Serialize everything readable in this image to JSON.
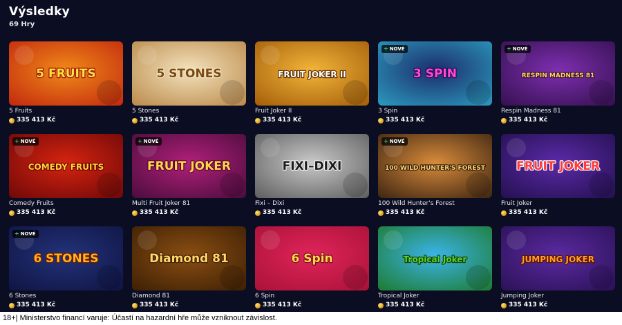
{
  "header": {
    "title": "Výsledky",
    "count": "69 Hry"
  },
  "badge_label": "NOVÉ",
  "games": [
    {
      "name": "5 Fruits",
      "jackpot": "335 413 Kč",
      "logo": "5 FRUITS",
      "new": false,
      "theme": "orange"
    },
    {
      "name": "5 Stones",
      "jackpot": "335 413 Kč",
      "logo": "5 STONES",
      "new": false,
      "theme": "desert"
    },
    {
      "name": "Fruit Joker II",
      "jackpot": "335 413 Kč",
      "logo": "FRUIT JOKER II",
      "new": false,
      "theme": "gold"
    },
    {
      "name": "3 Spin",
      "jackpot": "335 413 Kč",
      "logo": "3 SPIN",
      "new": true,
      "theme": "beach"
    },
    {
      "name": "Respin Madness 81",
      "jackpot": "335 413 Kč",
      "logo": "RESPIN MADNESS 81",
      "new": true,
      "theme": "purple"
    },
    {
      "name": "Comedy Fruits",
      "jackpot": "335 413 Kč",
      "logo": "COMEDY FRUITS",
      "new": true,
      "theme": "red"
    },
    {
      "name": "Multi Fruit Joker 81",
      "jackpot": "335 413 Kč",
      "logo": "FRUIT JOKER",
      "new": true,
      "theme": "magenta"
    },
    {
      "name": "Fixi – Dixi",
      "jackpot": "335 413 Kč",
      "logo": "FIXI–DIXI",
      "new": false,
      "theme": "grey"
    },
    {
      "name": "100 Wild Hunter's Forest",
      "jackpot": "335 413 Kč",
      "logo": "100 WILD HUNTER'S FOREST",
      "new": true,
      "theme": "forest"
    },
    {
      "name": "Fruit Joker",
      "jackpot": "335 413 Kč",
      "logo": "FRUIT JOKER",
      "new": false,
      "theme": "violet"
    },
    {
      "name": "6 Stones",
      "jackpot": "335 413 Kč",
      "logo": "6 STONES",
      "new": true,
      "theme": "navy"
    },
    {
      "name": "Diamond 81",
      "jackpot": "335 413 Kč",
      "logo": "Diamond 81",
      "new": false,
      "theme": "bronze"
    },
    {
      "name": "6 Spin",
      "jackpot": "335 413 Kč",
      "logo": "6 Spin",
      "new": false,
      "theme": "crimson"
    },
    {
      "name": "Tropical Joker",
      "jackpot": "335 413 Kč",
      "logo": "Tropical Joker",
      "new": false,
      "theme": "jungle"
    },
    {
      "name": "Jumping Joker",
      "jackpot": "335 413 Kč",
      "logo": "JUMPING JOKER",
      "new": false,
      "theme": "deepviolet"
    }
  ],
  "themes": {
    "orange": {
      "bg1": "#f08a1a",
      "bg2": "#c2270d",
      "text": "#ffe23d",
      "stroke": "#9a0f0f"
    },
    "desert": {
      "bg1": "#f4e2bd",
      "bg2": "#b98949",
      "text": "#7a4a16",
      "stroke": "#f4e2bd"
    },
    "gold": {
      "bg1": "#f3b53a",
      "bg2": "#a35d09",
      "text": "#ffffff",
      "stroke": "#5a2c02"
    },
    "beach": {
      "bg1": "#1c2d6b",
      "bg2": "#2c9bbf",
      "text": "#ff4ad0",
      "stroke": "#2a0a55"
    },
    "purple": {
      "bg1": "#7e2fb0",
      "bg2": "#34104f",
      "text": "#ffd54a",
      "stroke": "#3a0d52"
    },
    "red": {
      "bg1": "#d6240f",
      "bg2": "#6e0809",
      "text": "#ffd43a",
      "stroke": "#6b0000"
    },
    "magenta": {
      "bg1": "#b1207a",
      "bg2": "#4a0c3c",
      "text": "#ffd84a",
      "stroke": "#5a0033"
    },
    "grey": {
      "bg1": "#c9c9c9",
      "bg2": "#5d5d5d",
      "text": "#1c1c1c",
      "stroke": "#f0f0f0"
    },
    "forest": {
      "bg1": "#d98b3b",
      "bg2": "#3b2411",
      "text": "#f3d27d",
      "stroke": "#3a1e07"
    },
    "violet": {
      "bg1": "#5b2aa8",
      "bg2": "#23104f",
      "text": "#ff3c3c",
      "stroke": "#ffffff"
    },
    "navy": {
      "bg1": "#23327a",
      "bg2": "#0f1442",
      "text": "#ffb21e",
      "stroke": "#6b1b00"
    },
    "bronze": {
      "bg1": "#8a4e12",
      "bg2": "#3d1f05",
      "text": "#ffd66a",
      "stroke": "#3d1f05"
    },
    "crimson": {
      "bg1": "#e0245a",
      "bg2": "#a81237",
      "text": "#ffd84a",
      "stroke": "#7a0a22"
    },
    "jungle": {
      "bg1": "#3bb4ea",
      "bg2": "#1d7a2c",
      "text": "#5bd12a",
      "stroke": "#0d3f0a"
    },
    "deepviolet": {
      "bg1": "#5b2aa0",
      "bg2": "#2a1157",
      "text": "#ff9e2a",
      "stroke": "#5a1200"
    }
  },
  "footer": {
    "text": "18+| Ministerstvo financí varuje: Účastí na hazardní hře může vzniknout závislost."
  }
}
